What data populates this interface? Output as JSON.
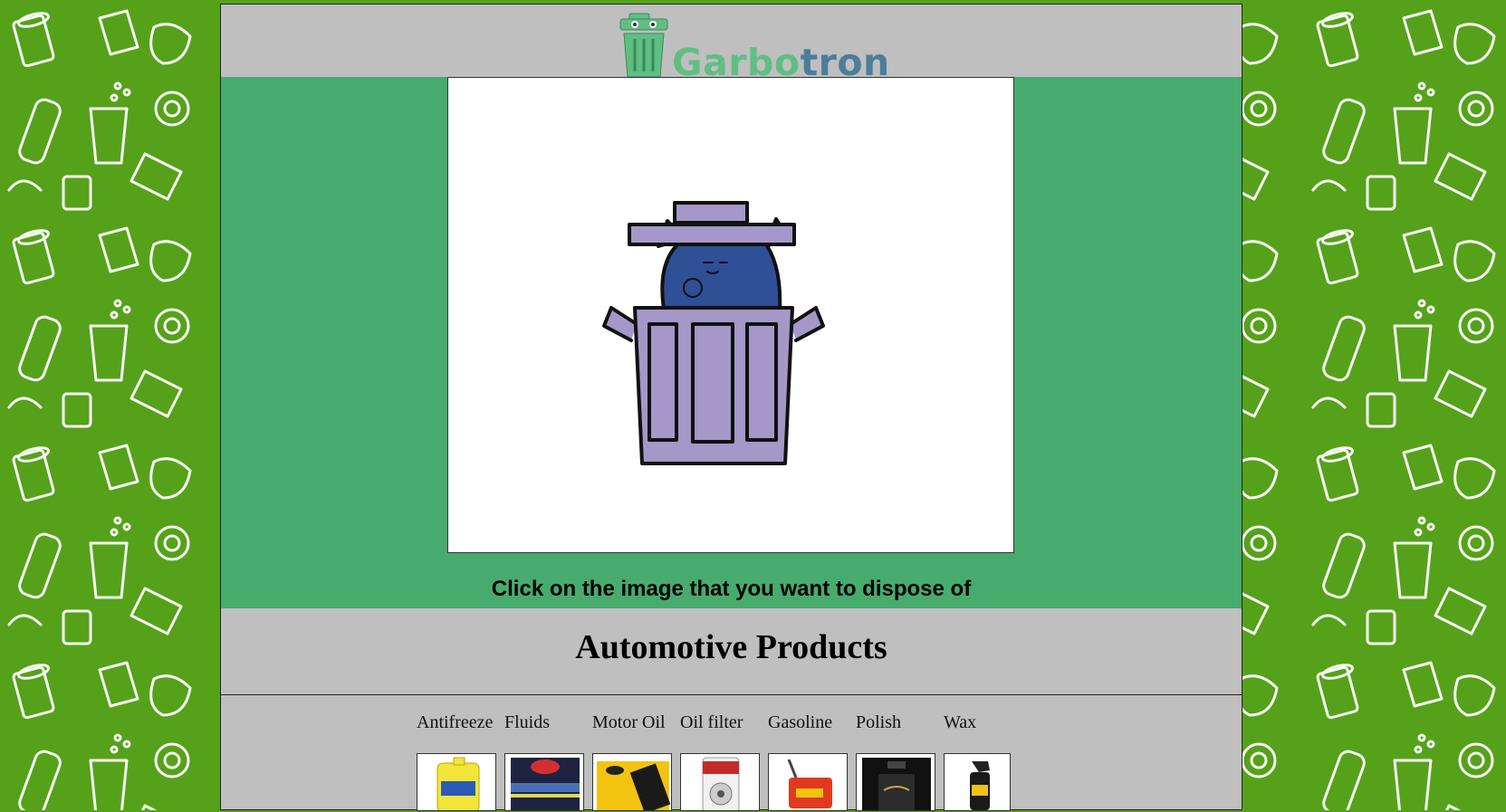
{
  "brand": {
    "part1": "Garbo",
    "part2": "tron"
  },
  "hero": {
    "caption": "Click on the image that you want to dispose of"
  },
  "section": {
    "title": "Automotive Products"
  },
  "products": [
    {
      "label": "Antifreeze",
      "icon": "antifreeze-jug-icon"
    },
    {
      "label": "Fluids",
      "icon": "fluid-bottle-icon"
    },
    {
      "label": "Motor Oil",
      "icon": "motor-oil-bottle-icon"
    },
    {
      "label": "Oil filter",
      "icon": "oil-filter-icon"
    },
    {
      "label": "Gasoline",
      "icon": "gas-can-icon"
    },
    {
      "label": "Polish",
      "icon": "polish-bottle-icon"
    },
    {
      "label": "Wax",
      "icon": "wax-spray-icon"
    }
  ],
  "colors": {
    "background": "#56a11a",
    "panel": "#bfbfbf",
    "hero": "#48ab6e",
    "bin": "#a697c9",
    "monster": "#2f4f96"
  }
}
